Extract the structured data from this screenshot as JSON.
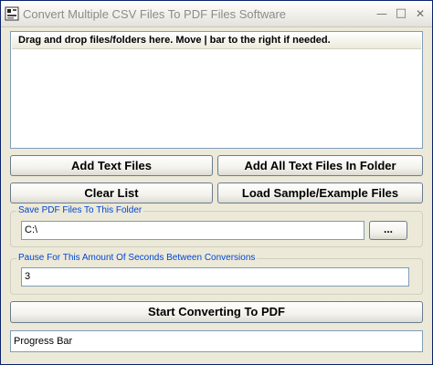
{
  "window": {
    "title": "Convert Multiple CSV Files To PDF Files Software",
    "minimize_icon": "minimize-icon",
    "maximize_icon": "maximize-icon",
    "close_icon": "close-icon",
    "minimize_glyph": "—",
    "maximize_glyph": "□",
    "close_glyph": "✕"
  },
  "dropzone": {
    "header": "Drag and drop files/folders here. Move | bar to the right if needed."
  },
  "buttons": {
    "add_text_files": "Add Text Files",
    "add_all_text_files": "Add All Text Files In Folder",
    "clear_list": "Clear List",
    "load_sample": "Load Sample/Example Files",
    "browse": "...",
    "start": "Start Converting To PDF"
  },
  "save_group": {
    "label": "Save PDF Files To This Folder",
    "folder_value": "C:\\"
  },
  "pause_group": {
    "label": "Pause For This Amount Of Seconds Between Conversions",
    "seconds_value": "3"
  },
  "progress": {
    "label": "Progress Bar"
  },
  "colors": {
    "window_bg": "#ece9d8",
    "group_label": "#0046d5",
    "input_border": "#7f9db9"
  }
}
